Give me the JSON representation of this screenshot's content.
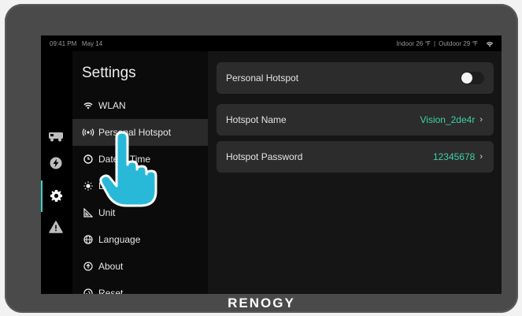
{
  "status_bar": {
    "time": "09:41 PM",
    "date": "May 14",
    "indoor": "Indoor 26 ℉",
    "outdoor": "Outdoor 29 ℉"
  },
  "rail": {
    "icons": [
      "rv-icon",
      "bolt-icon",
      "gear-icon",
      "warning-icon"
    ],
    "active": "gear-icon"
  },
  "menu": {
    "title": "Settings",
    "items": [
      {
        "label": "WLAN",
        "icon": "wifi-icon"
      },
      {
        "label": "Personal Hotspot",
        "icon": "hotspot-icon",
        "selected": true
      },
      {
        "label": "Date & Time",
        "icon": "clock-icon"
      },
      {
        "label": "Display",
        "icon": "brightness-icon"
      },
      {
        "label": "Unit",
        "icon": "ruler-icon"
      },
      {
        "label": "Language",
        "icon": "globe-icon"
      },
      {
        "label": "About",
        "icon": "info-icon"
      },
      {
        "label": "Reset",
        "icon": "reset-icon"
      }
    ]
  },
  "hotspot": {
    "toggle_label": "Personal Hotspot",
    "toggle_on": false,
    "name_label": "Hotspot Name",
    "name_value": "Vision_2de4r",
    "password_label": "Hotspot Password",
    "password_value": "12345678",
    "chevron": "›"
  },
  "brand": "RENOGY",
  "colors": {
    "accent": "#3bd1c5",
    "value_text": "#3fd0a6",
    "hand": "#29b9d8"
  }
}
